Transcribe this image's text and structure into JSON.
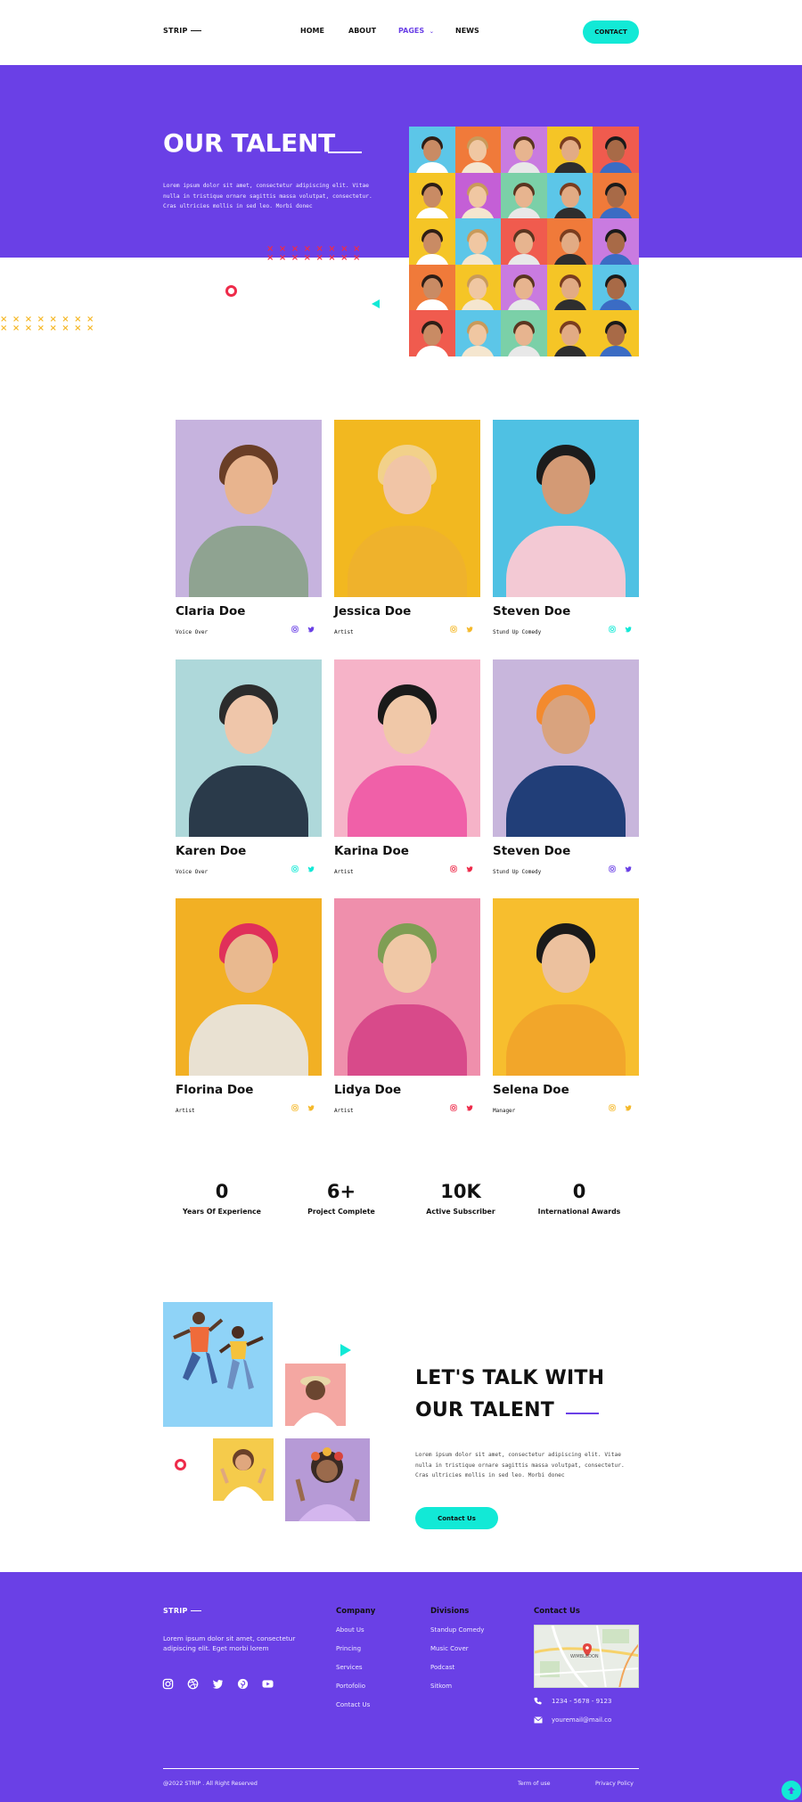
{
  "brand": {
    "logo": "STRIP"
  },
  "nav": {
    "items": [
      "HOME",
      "ABOUT",
      "PAGES",
      "NEWS"
    ],
    "active": "PAGES",
    "contact_label": "CONTACT"
  },
  "hero": {
    "title": "OUR TALENT",
    "text": "Lorem ipsum dolor sit amet, consectetur adipiscing elit. Vitae nulla in tristique ornare sagittis massa volutpat, consectetur. Cras ultricies mollis in sed leo. Morbi donec",
    "xmarks_red": "× × × × × × × ×",
    "xmarks_yellow": "× × × × × × × ×"
  },
  "talents": [
    {
      "name": "Claria Doe",
      "role": "Voice Over"
    },
    {
      "name": "Jessica Doe",
      "role": "Artist"
    },
    {
      "name": "Steven Doe",
      "role": "Stund Up Comedy"
    },
    {
      "name": "Karen Doe",
      "role": "Voice Over"
    },
    {
      "name": "Karina Doe",
      "role": "Artist"
    },
    {
      "name": "Steven Doe",
      "role": "Stund Up Comedy"
    },
    {
      "name": "Florina Doe",
      "role": "Artist"
    },
    {
      "name": "Lidya Doe",
      "role": "Artist"
    },
    {
      "name": "Selena Doe",
      "role": "Manager"
    }
  ],
  "stats": [
    {
      "value": "0",
      "label": "Years Of Experience"
    },
    {
      "value": "6+",
      "label": "Project Complete"
    },
    {
      "value": "10K",
      "label": "Active Subscriber"
    },
    {
      "value": "0",
      "label": "International Awards"
    }
  ],
  "talk": {
    "title_line1": "LET'S TALK WITH",
    "title_line2": "OUR TALENT",
    "text": "Lorem ipsum dolor sit amet, consectetur adipiscing elit. Vitae nulla in tristique ornare sagittis massa volutpat, consectetur. Cras ultricies mollis in sed leo. Morbi donec",
    "button": "Contact Us"
  },
  "footer": {
    "logo": "STRIP",
    "description": "Lorem ipsum dolor sit amet, consectetur adipiscing elit. Eget morbi lorem",
    "company": {
      "heading": "Company",
      "links": [
        "About Us",
        "Princing",
        "Services",
        "Portofolio",
        "Contact Us"
      ]
    },
    "divisions": {
      "heading": "Divisions",
      "links": [
        "Standup Comedy",
        "Music Cover",
        "Podcast",
        "Sitkom"
      ]
    },
    "contact": {
      "heading": "Contact Us",
      "phone": "1234 - 5678 - 9123",
      "email": "youremail@mail.co",
      "map_label": "WIMBLEDON"
    },
    "copyright": "@2022 STRIP . All Right Reserved",
    "terms": "Term of use",
    "privacy": "Privacy Policy",
    "social_icons": [
      "instagram-icon",
      "dribbble-icon",
      "twitter-icon",
      "pinterest-icon",
      "youtube-icon"
    ]
  },
  "colors": {
    "primary": "#6a40e6",
    "accent": "#12e9d6",
    "red": "#ee2b4a",
    "yellow": "#f5b92b"
  }
}
